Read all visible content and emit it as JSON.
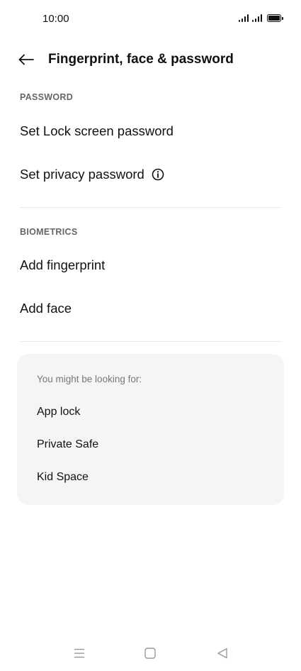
{
  "status_bar": {
    "time": "10:00",
    "icons": [
      "signal-icon",
      "signal-icon",
      "battery-icon"
    ]
  },
  "header": {
    "back_icon": "arrow-left-icon",
    "title": "Fingerprint, face & password"
  },
  "sections": {
    "password": {
      "label": "PASSWORD",
      "items": [
        {
          "label": "Set Lock screen password"
        },
        {
          "label": "Set privacy password",
          "icon": "info-icon"
        }
      ]
    },
    "biometrics": {
      "label": "BIOMETRICS",
      "items": [
        {
          "label": "Add fingerprint"
        },
        {
          "label": "Add face"
        }
      ]
    }
  },
  "suggestions": {
    "heading": "You might be looking for:",
    "items": [
      {
        "label": "App lock"
      },
      {
        "label": "Private Safe"
      },
      {
        "label": "Kid Space"
      }
    ]
  },
  "nav_bar": {
    "icons": [
      "menu-icon",
      "home-icon",
      "back-triangle-icon"
    ]
  },
  "colors": {
    "background": "#ffffff",
    "text_primary": "#111111",
    "text_secondary": "#666666",
    "card_background": "#f5f5f5",
    "divider": "#e6e6e6"
  }
}
